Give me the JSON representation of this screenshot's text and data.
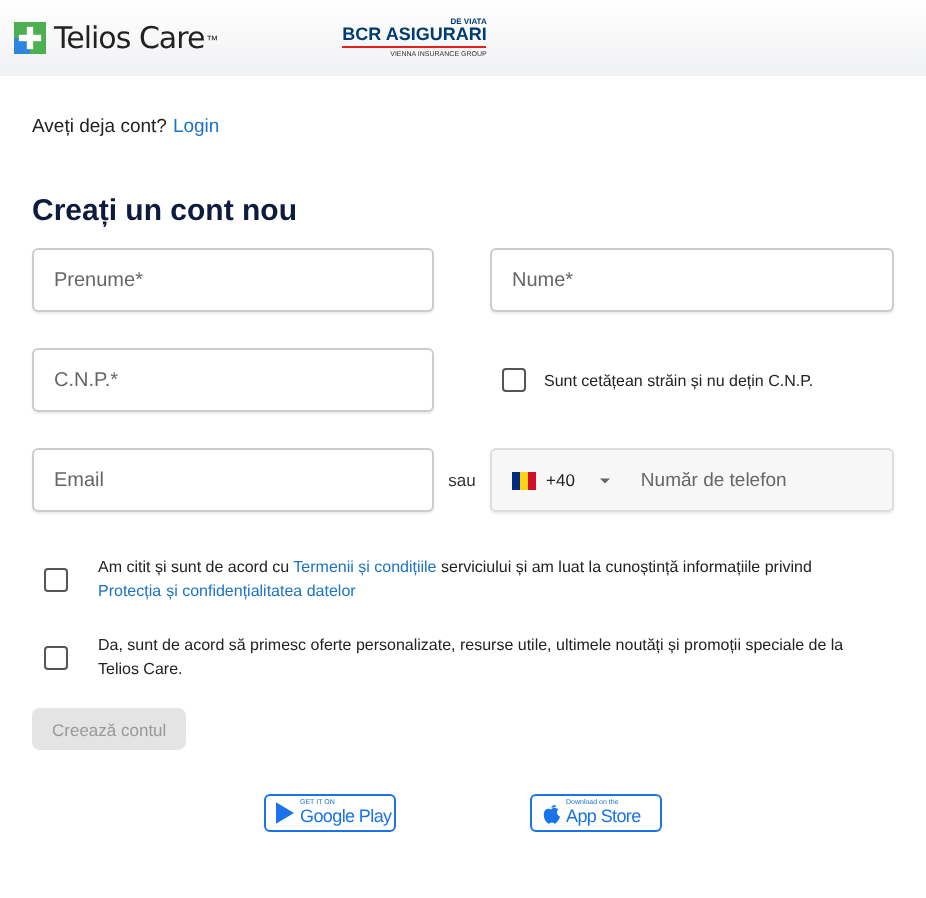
{
  "header": {
    "brand": "Telios Care",
    "brand_mark": "™",
    "partner": {
      "top": "DE VIATA",
      "name": "BCR ASIGURARI",
      "sub": "VIENNA INSURANCE GROUP"
    }
  },
  "login_prompt": {
    "text": "Aveți deja cont?",
    "link": "Login"
  },
  "title": "Creați un cont nou",
  "fields": {
    "first_name": {
      "placeholder": "Prenume*"
    },
    "last_name": {
      "placeholder": "Nume*"
    },
    "cnp": {
      "placeholder": "C.N.P.*"
    },
    "email": {
      "placeholder": "Email"
    },
    "phone": {
      "country_code": "+40",
      "placeholder": "Număr de telefon"
    }
  },
  "foreigner": {
    "label": "Sunt cetățean străin și nu dețin C.N.P.",
    "checked": false
  },
  "or_label": "sau",
  "consents": [
    {
      "checked": false,
      "parts": [
        {
          "kind": "text",
          "text": "Am citit și sunt de acord cu "
        },
        {
          "kind": "link",
          "text": "Termenii și condițiile"
        },
        {
          "kind": "text",
          "text": " serviciului și am luat la cunoștință informațiile privind "
        },
        {
          "kind": "link",
          "text": "Protecția"
        },
        {
          "kind": "link",
          "text": "și confidențialitatea datelor"
        }
      ]
    },
    {
      "checked": false,
      "parts": [
        {
          "kind": "text",
          "text": "Da, sunt de acord să primesc oferte personalizate, resurse utile, ultimele noutăți și promoții speciale de la Telios Care."
        }
      ]
    }
  ],
  "submit": {
    "label": "Creează contul",
    "disabled": true
  },
  "stores": [
    {
      "kind": "google",
      "small": "GET IT ON",
      "big": "Google Play"
    },
    {
      "kind": "apple",
      "small": "Download on the",
      "big": "App Store"
    }
  ]
}
